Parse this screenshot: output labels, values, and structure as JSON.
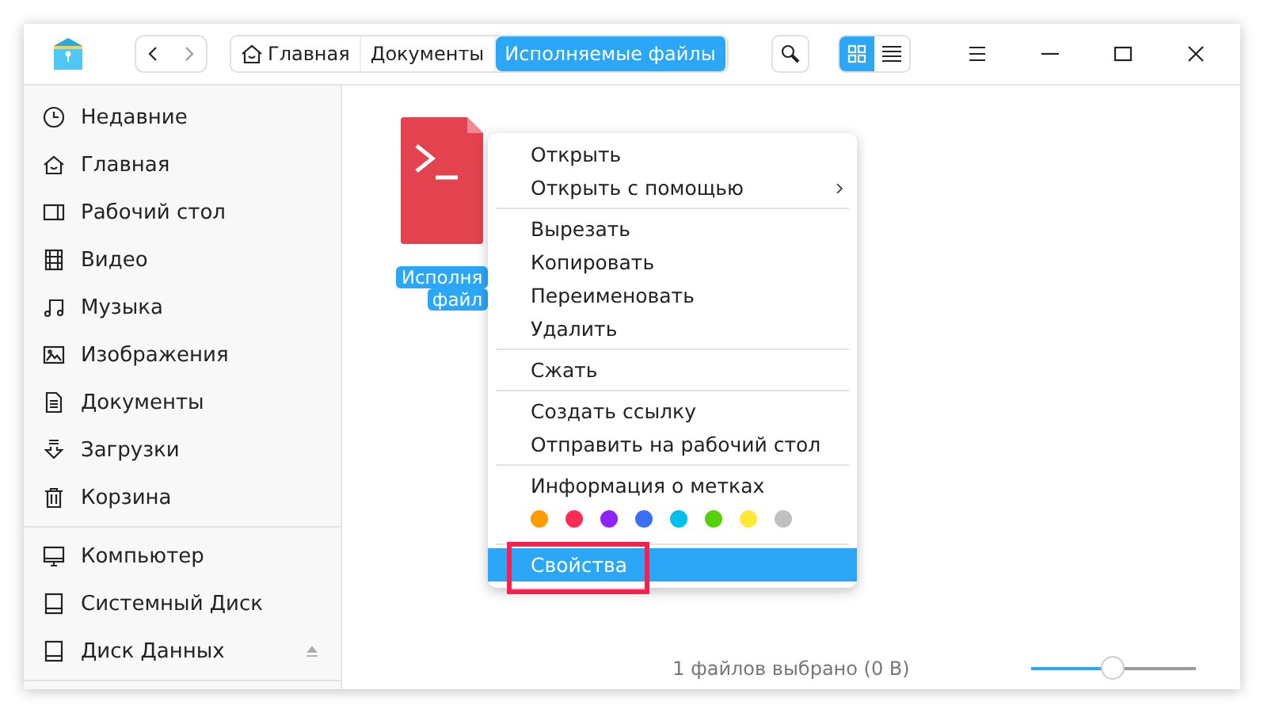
{
  "toolbar": {
    "breadcrumbs": [
      {
        "label": "Главная",
        "kind": "home",
        "selected": false
      },
      {
        "label": "Документы",
        "kind": "folder",
        "selected": false
      },
      {
        "label": "Исполняемые файлы",
        "kind": "folder",
        "selected": true
      }
    ],
    "view_modes": [
      {
        "kind": "grid",
        "selected": true
      },
      {
        "kind": "list",
        "selected": false
      }
    ]
  },
  "sidebar": {
    "groups": [
      [
        {
          "label": "Недавние",
          "kind": "clock",
          "eject": false
        },
        {
          "label": "Главная",
          "kind": "home",
          "eject": false
        },
        {
          "label": "Рабочий стол",
          "kind": "desktop",
          "eject": false
        },
        {
          "label": "Видео",
          "kind": "film",
          "eject": false
        },
        {
          "label": "Музыка",
          "kind": "music",
          "eject": false
        },
        {
          "label": "Изображения",
          "kind": "image",
          "eject": false
        },
        {
          "label": "Документы",
          "kind": "doc",
          "eject": false
        },
        {
          "label": "Загрузки",
          "kind": "download",
          "eject": false
        },
        {
          "label": "Корзина",
          "kind": "trash",
          "eject": false
        }
      ],
      [
        {
          "label": "Компьютер",
          "kind": "computer",
          "eject": false
        },
        {
          "label": "Системный Диск",
          "kind": "disk",
          "eject": false
        },
        {
          "label": "Диск Данных",
          "kind": "disk",
          "eject": true
        }
      ]
    ]
  },
  "files": [
    {
      "label_lines": [
        "Исполня",
        "файл"
      ],
      "selected": true
    }
  ],
  "context_menu": [
    {
      "kind": "item",
      "label": "Открыть",
      "submenu": false,
      "selected": false
    },
    {
      "kind": "item",
      "label": "Открыть с помощью",
      "submenu": true,
      "selected": false
    },
    {
      "kind": "separator"
    },
    {
      "kind": "item",
      "label": "Вырезать",
      "submenu": false,
      "selected": false
    },
    {
      "kind": "item",
      "label": "Копировать",
      "submenu": false,
      "selected": false
    },
    {
      "kind": "item",
      "label": "Переименовать",
      "submenu": false,
      "selected": false
    },
    {
      "kind": "item",
      "label": "Удалить",
      "submenu": false,
      "selected": false
    },
    {
      "kind": "separator"
    },
    {
      "kind": "item",
      "label": "Сжать",
      "submenu": false,
      "selected": false
    },
    {
      "kind": "separator"
    },
    {
      "kind": "item",
      "label": "Создать ссылку",
      "submenu": false,
      "selected": false
    },
    {
      "kind": "item",
      "label": "Отправить на рабочий стол",
      "submenu": false,
      "selected": false
    },
    {
      "kind": "separator"
    },
    {
      "kind": "item",
      "label": "Информация о метках",
      "submenu": false,
      "selected": false
    },
    {
      "kind": "tags",
      "tags": [
        {
          "color": "#ff9c00"
        },
        {
          "color": "#ff2d55"
        },
        {
          "color": "#9023fc"
        },
        {
          "color": "#3d6ff5"
        },
        {
          "color": "#00bff0"
        },
        {
          "color": "#58d10c"
        },
        {
          "color": "#fee93b"
        },
        {
          "color": "#c0c0c0"
        }
      ]
    },
    {
      "kind": "separator"
    },
    {
      "kind": "item",
      "label": "Свойства",
      "submenu": false,
      "selected": true,
      "highlighted": true
    }
  ],
  "status_bar": {
    "text": "1 файлов выбрано (0 B)",
    "zoom": {
      "level": 0.5
    }
  }
}
